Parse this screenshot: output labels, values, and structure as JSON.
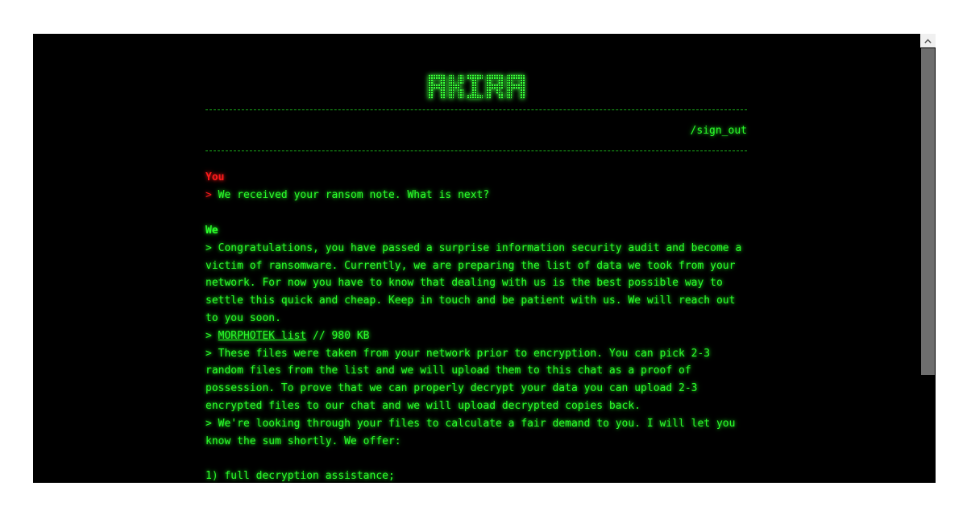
{
  "logo": {
    "text": "AKIRA"
  },
  "nav": {
    "sign_out": "/sign_out"
  },
  "messages": [
    {
      "sender": "You",
      "lines": [
        "> We received your ransom note. What is next?"
      ]
    },
    {
      "sender": "We",
      "paragraphs": [
        "> Congratulations, you have passed a surprise information security audit and become a victim of ransomware. Currently, we are preparing the list of data we took from your network. For now you have to know that dealing with us is the best possible way to settle this quick and cheap. Keep in touch and be patient with us. We will reach out to you soon.",
        "> These files were taken from your network prior to encryption. You can pick 2-3 random files from the list and we will upload them to this chat as a proof of possession. To prove that we can properly decrypt your data you can upload 2-3 encrypted files to our chat and we will upload decrypted copies back.",
        "> We're looking through your files to calculate a fair demand to you. I will let you know the sum shortly. We offer:",
        "1) full decryption assistance;"
      ],
      "file": {
        "prefix": "> ",
        "name": "MORPHOTEK list",
        "size": " // 980 KB"
      }
    }
  ],
  "colors": {
    "background": "#000000",
    "text_green": "#2bff2b",
    "sender_red": "#ff1a1a",
    "scroll_thumb": "#6e6e6e"
  }
}
